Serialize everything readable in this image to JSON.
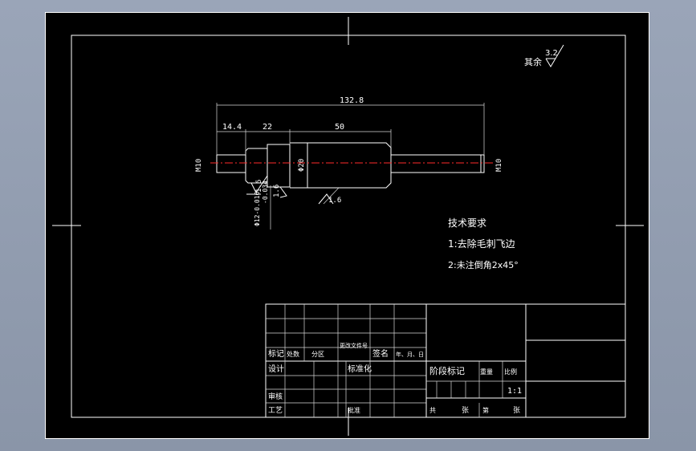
{
  "drawing": {
    "roughness_note": {
      "label": "其余",
      "value": "3.2"
    },
    "dimensions": {
      "overall_length": "132.8",
      "left_segment": "14.4",
      "second_segment": "22",
      "middle_segment": "50",
      "left_thread": "M10",
      "right_thread": "M10",
      "middle_diameter": "Φ20",
      "shoulder_diameter": "Φ12-0.016",
      "shoulder_tolerance": "-0.034"
    },
    "roughness": {
      "a": "1.6",
      "b": "1.6",
      "c": "1.6"
    },
    "tech_requirements": {
      "title": "技术要求",
      "item1": "1:去除毛刺飞边",
      "item2": "2:未注倒角2x45°"
    }
  },
  "title_block": {
    "row_labels": {
      "mark": "标记",
      "count": "处数",
      "zone": "分区",
      "change_doc": "更改文件号",
      "sign": "签名",
      "date": "年、月、日"
    },
    "design": "设计",
    "standardize": "标准化",
    "review": "审核",
    "process": "工艺",
    "approve": "批准",
    "stage_mark": "阶段标记",
    "weight": "重量",
    "scale_label": "比例",
    "scale_value": "1:1",
    "sheets_total": "共",
    "sheets_unit": "张",
    "sheet_no": "第",
    "sheet_unit2": "张"
  }
}
